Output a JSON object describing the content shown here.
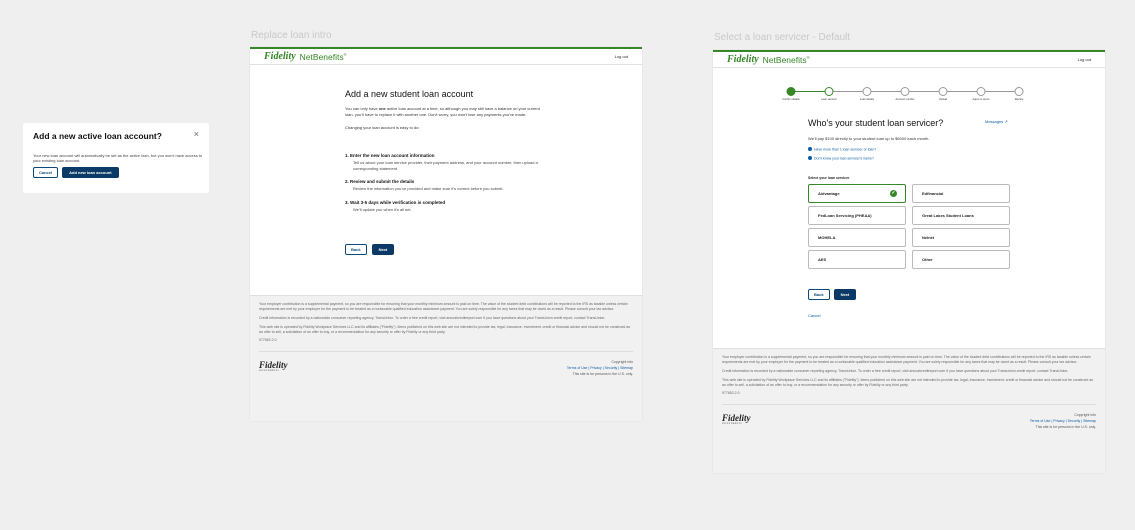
{
  "labels": {
    "left": "Replace loan intro",
    "right": "Select a loan servicer - Default"
  },
  "modal": {
    "title": "Add a new active loan account?",
    "close": "×",
    "body": "Your new loan account will automatically be set as the active loan, but you won't have access to your existing loan account.",
    "cancel": "Cancel",
    "confirm": "Add new loan account"
  },
  "header": {
    "brand": "Fidelity",
    "product": "NetBenefits",
    "product_mark": "®",
    "logout": "Log out"
  },
  "intro_page": {
    "title": "Add a new student loan account",
    "intro_pre": "You can only have ",
    "intro_bold": "one",
    "intro_post": " active loan account at a time, so although you may still have a balance on your current loan, you'll have to replace it with another one. Don't worry, you won't lose any payments you've made.",
    "easy": "Changing your loan account is easy to do:",
    "steps": [
      {
        "title": "1.  Enter the new loan account information",
        "desc": "Tell us about your loan service provider, their payment address, and your account number, then upload a corresponding statement."
      },
      {
        "title": "2.  Review and submit the details",
        "desc": "Review the information you've provided and make sure it's correct before you submit."
      },
      {
        "title": "3.  Wait 3-5 days while verification is completed",
        "desc": "We'll update you when it's all set."
      }
    ],
    "back": "Back",
    "next": "Next"
  },
  "footer": {
    "p1": "Your employer contribution is a supplemental payment, so you are responsible for ensuring that your monthly minimum amount is paid on time. The value of the student debt contributions will be reported to the IRS as taxable unless certain requirements are met by your employer for the payment to be treated as a nontaxable qualified education assistance payment. You are solely responsible for any taxes that may be owed as a result. Please consult your tax advisor.",
    "p2": "Credit information is recorded by a nationwide consumer reporting agency, TransUnion. To order a free credit report, visit annualcreditreport.com If you have questions about your TransUnion credit report, contact TransUnion.",
    "p3": "This web site is operated by Fidelity Workplace Services LLC and its affiliates (\"Fidelity\"). Items published on this web site are not intended to provide tax, legal, insurance, investment, credit or financial advice and should not be construed as an offer to sell, a solicitation of an offer to buy, or a recommendation for any security or offer by Fidelity or any third party.",
    "code": "977652.2.0",
    "logo": "Fidelity",
    "logo_sub": "INVESTMENTS",
    "copyright": "Copyright info",
    "links": "Terms of Use  |  Privacy  |  Security  |  Sitemap",
    "notice": "This site is for persons in the U.S. only."
  },
  "servicer_page": {
    "progress": [
      {
        "label": "Confirm details",
        "state": "done"
      },
      {
        "label": "Loan servicer",
        "state": "current"
      },
      {
        "label": "Loan details",
        "state": "todo"
      },
      {
        "label": "Account number",
        "state": "todo"
      },
      {
        "label": "Upload",
        "state": "todo"
      },
      {
        "label": "Agree to terms",
        "state": "todo"
      },
      {
        "label": "Review",
        "state": "todo"
      }
    ],
    "title": "Who's your student loan servicer?",
    "messages": "Messages",
    "sub": "We'll pay $100 directly to your student loan up to $6000 each month.",
    "link1": "Have more than 1 loan servicer or loan?",
    "link2": "Don't know your loan servicer's name?",
    "select_label": "Select your loan servicer",
    "options": [
      "Aidvantage",
      "Edfinancial",
      "FedLoan Servicing (PHEAA)",
      "Great Lakes Student Loans",
      "MOHELA",
      "Nelnet",
      "AES",
      "Other"
    ],
    "selected": "Aidvantage",
    "back": "Back",
    "next": "Next",
    "cancel": "Cancel"
  },
  "colors": {
    "brand_green": "#368727",
    "primary_blue": "#0b3a66",
    "link_blue": "#0b5da6"
  }
}
